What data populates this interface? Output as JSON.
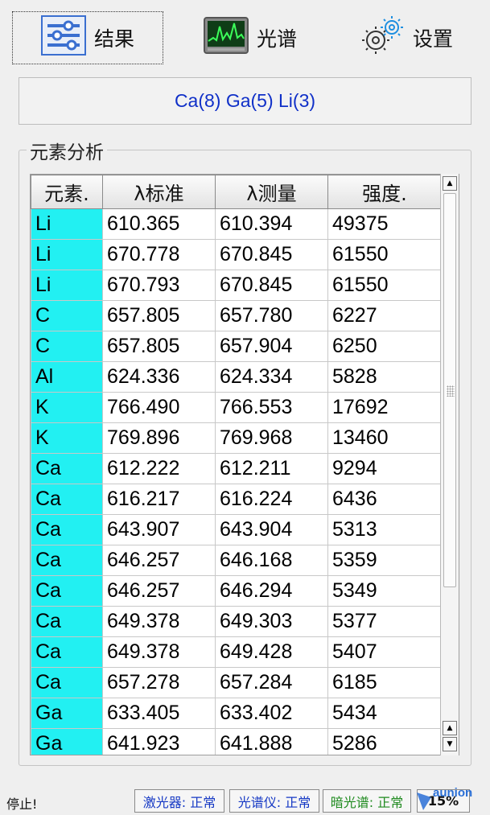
{
  "toolbar": {
    "results_label": "结果",
    "spectrum_label": "光谱",
    "settings_label": "设置"
  },
  "summary": "Ca(8) Ga(5) Li(3)",
  "group_title": "元素分析",
  "table": {
    "headers": [
      "元素.",
      "λ标准",
      "λ测量",
      "强度."
    ],
    "rows": [
      [
        "Li",
        "610.365",
        "610.394",
        "49375"
      ],
      [
        "Li",
        "670.778",
        "670.845",
        "61550"
      ],
      [
        "Li",
        "670.793",
        "670.845",
        "61550"
      ],
      [
        "C",
        "657.805",
        "657.780",
        "6227"
      ],
      [
        "C",
        "657.805",
        "657.904",
        "6250"
      ],
      [
        "Al",
        "624.336",
        "624.334",
        "5828"
      ],
      [
        "K",
        "766.490",
        "766.553",
        "17692"
      ],
      [
        "K",
        "769.896",
        "769.968",
        "13460"
      ],
      [
        "Ca",
        "612.222",
        "612.211",
        "9294"
      ],
      [
        "Ca",
        "616.217",
        "616.224",
        "6436"
      ],
      [
        "Ca",
        "643.907",
        "643.904",
        "5313"
      ],
      [
        "Ca",
        "646.257",
        "646.168",
        "5359"
      ],
      [
        "Ca",
        "646.257",
        "646.294",
        "5349"
      ],
      [
        "Ca",
        "649.378",
        "649.303",
        "5377"
      ],
      [
        "Ca",
        "649.378",
        "649.428",
        "5407"
      ],
      [
        "Ca",
        "657.278",
        "657.284",
        "6185"
      ],
      [
        "Ga",
        "633.405",
        "633.402",
        "5434"
      ],
      [
        "Ga",
        "641.923",
        "641.888",
        "5286"
      ]
    ],
    "element_cell_color": "#22f0f2"
  },
  "status": {
    "left": "停止!",
    "laser": "激光器: 正常",
    "spectrometer": "光谱仪: 正常",
    "dark_spectrum": "暗光谱: 正常",
    "percent": "15%"
  },
  "watermark": "aunion",
  "colors": {
    "summary_text": "#1030c8",
    "status_ok_blue": "#1538c4",
    "status_ok_green": "#1f8a1f"
  }
}
